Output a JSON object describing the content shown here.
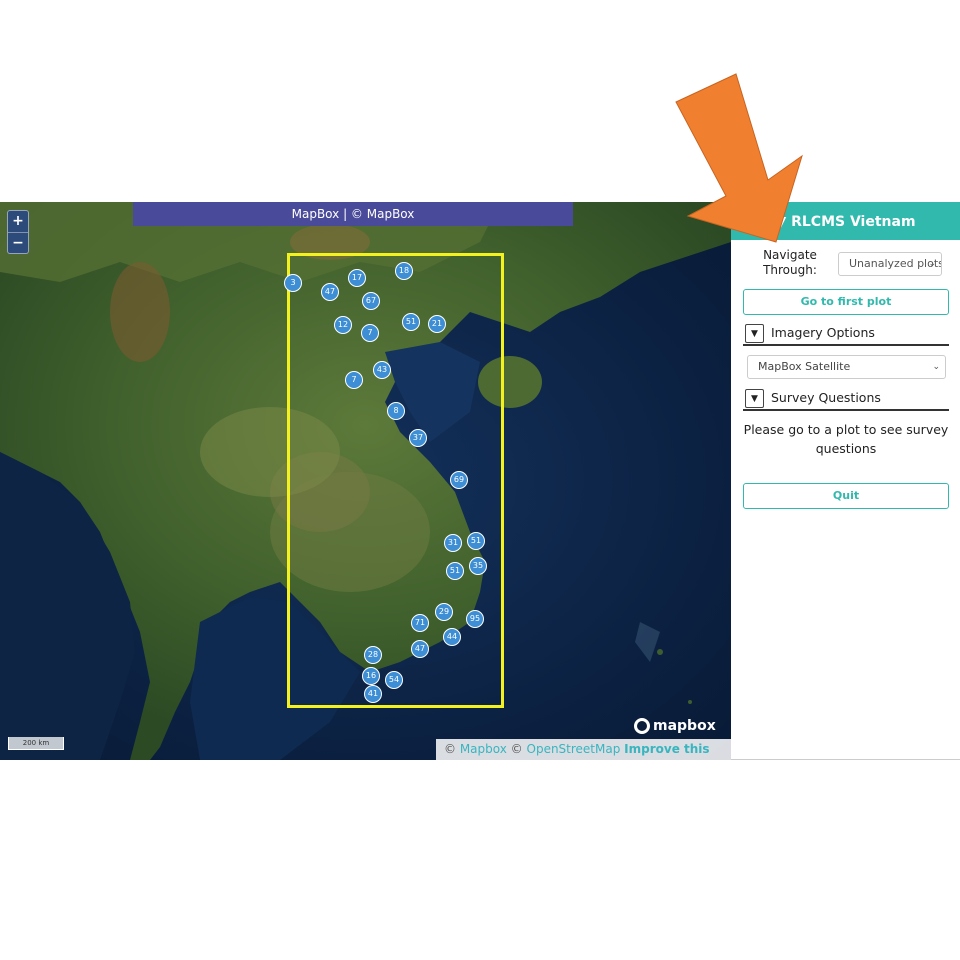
{
  "map": {
    "attribution_banner": "MapBox | © MapBox",
    "zoom_in_label": "+",
    "zoom_out_label": "−",
    "scale_label": "200 km",
    "logo_text": "mapbox",
    "attribution": {
      "copy1": "©",
      "mapbox_link": "Mapbox",
      "copy2": "©",
      "osm_link": "OpenStreetMap",
      "improve_link": "Improve this map"
    },
    "clusters": [
      {
        "count": "3"
      },
      {
        "count": "47"
      },
      {
        "count": "17"
      },
      {
        "count": "18"
      },
      {
        "count": "67"
      },
      {
        "count": "12"
      },
      {
        "count": "7"
      },
      {
        "count": "51"
      },
      {
        "count": "21"
      },
      {
        "count": "43"
      },
      {
        "count": "7"
      },
      {
        "count": "8"
      },
      {
        "count": "37"
      },
      {
        "count": "69"
      },
      {
        "count": "31"
      },
      {
        "count": "51"
      },
      {
        "count": "51"
      },
      {
        "count": "35"
      },
      {
        "count": "29"
      },
      {
        "count": "71"
      },
      {
        "count": "95"
      },
      {
        "count": "44"
      },
      {
        "count": "47"
      },
      {
        "count": "28"
      },
      {
        "count": "16"
      },
      {
        "count": "54"
      },
      {
        "count": "41"
      }
    ],
    "colors": {
      "bbox": "#f4f21e",
      "marker": "#3d8ed4",
      "banner": "#4a4a9a"
    }
  },
  "sidebar": {
    "title": "▼ RLCMS Vietnam",
    "navigate_label": "Navigate Through:",
    "navigate_value": "Unanalyzed plots",
    "first_plot_button": "Go to first plot",
    "imagery_toggle": "▼",
    "imagery_title": "Imagery Options",
    "imagery_value": "MapBox Satellite",
    "survey_toggle": "▼",
    "survey_title": "Survey Questions",
    "survey_message": "Please go to a plot to see survey questions",
    "quit_button": "Quit",
    "colors": {
      "accent": "#31b9ad"
    }
  },
  "annotation": {
    "arrow_color": "#f08030"
  }
}
